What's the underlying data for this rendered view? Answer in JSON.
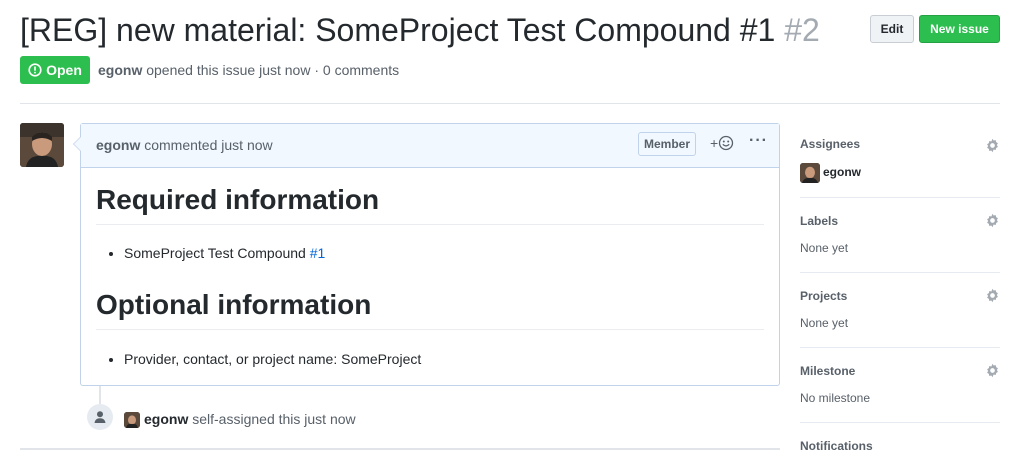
{
  "issue": {
    "title": "[REG] new material: SomeProject Test Compound #1",
    "number": "#2",
    "state": "Open",
    "author": "egonw",
    "meta_text": "opened this issue just now · 0 comments"
  },
  "header_buttons": {
    "edit": "Edit",
    "new_issue": "New issue"
  },
  "comment": {
    "author": "egonw",
    "action": "commented just now",
    "badge": "Member",
    "react_label": "+",
    "more_label": "···",
    "heading_required": "Required information",
    "required_item_text": "SomeProject Test Compound",
    "required_item_link": "#1",
    "heading_optional": "Optional information",
    "optional_item": "Provider, contact, or project name: SomeProject"
  },
  "event": {
    "actor": "egonw",
    "text": "self-assigned this just now"
  },
  "sidebar": {
    "assignees": {
      "heading": "Assignees",
      "value": "egonw"
    },
    "labels": {
      "heading": "Labels",
      "value": "None yet"
    },
    "projects": {
      "heading": "Projects",
      "value": "None yet"
    },
    "milestone": {
      "heading": "Milestone",
      "value": "No milestone"
    },
    "notifications": {
      "heading": "Notifications"
    }
  },
  "colors": {
    "open_green": "#2cbe4e",
    "link_blue": "#0366d6",
    "comment_header_bg": "#f1f8ff"
  }
}
